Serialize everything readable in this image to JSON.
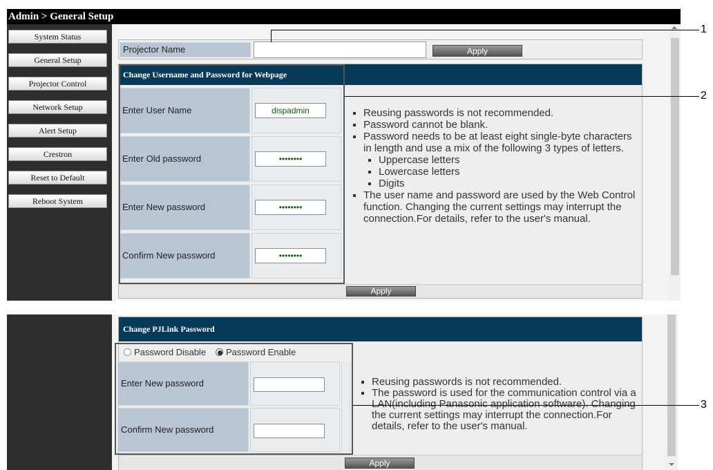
{
  "breadcrumb": "Admin > General Setup",
  "nav": [
    "System Status",
    "General Setup",
    "Projector Control",
    "Network Setup",
    "Alert Setup",
    "Crestron",
    "Reset to Default",
    "Reboot System"
  ],
  "projector_name": {
    "label": "Projector Name",
    "value": "",
    "apply": "Apply"
  },
  "webpage_section": {
    "title": "Change Username and Password for Webpage",
    "fields": [
      {
        "label": "Enter User Name",
        "value": "dispadmin"
      },
      {
        "label": "Enter Old password",
        "value": "••••••••"
      },
      {
        "label": "Enter New password",
        "value": "••••••••"
      },
      {
        "label": "Confirm New password",
        "value": "••••••••"
      }
    ],
    "notes": {
      "n1": "Reusing passwords is not recommended.",
      "n2": "Password cannot be blank.",
      "n3": "Password needs to be at least eight single-byte characters in length and use a mix of the following 3 types of letters.",
      "sub": [
        "Uppercase letters",
        "Lowercase letters",
        "Digits"
      ],
      "n4": "The user name and password are used by the Web Control function. Changing the current settings may interrupt the connection.For details, refer to the user's manual."
    },
    "apply": "Apply"
  },
  "pjlink_section": {
    "title": "Change PJLink Password",
    "radio_disable": "Password Disable",
    "radio_enable": "Password Enable",
    "selected": "Password Enable",
    "fields": [
      {
        "label": "Enter New password",
        "value": ""
      },
      {
        "label": "Confirm New password",
        "value": ""
      }
    ],
    "notes": {
      "n1": "Reusing passwords is not recommended.",
      "n2": "The password is used for the communication control via a LAN(including Panasonic application software). Changing the current settings may interrupt the connection.For details, refer to the user's manual."
    },
    "apply": "Apply"
  },
  "callouts": [
    "1",
    "2",
    "3"
  ]
}
